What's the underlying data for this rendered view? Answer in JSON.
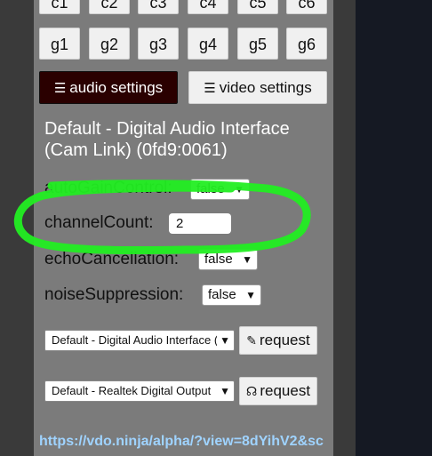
{
  "top_keys": [
    "c1",
    "c2",
    "c3",
    "c4",
    "c5",
    "c6"
  ],
  "g_keys": [
    "g1",
    "g2",
    "g3",
    "g4",
    "g5",
    "g6"
  ],
  "tabs": {
    "audio": {
      "label": "audio settings",
      "icon": "sliders-icon"
    },
    "video": {
      "label": "video settings",
      "icon": "sliders-icon"
    }
  },
  "device": {
    "title": "Default - Digital Audio Interface (Cam Link) (0fd9:0061)"
  },
  "settings": {
    "auto_gain": {
      "label": "autoGainControl:",
      "value": "false"
    },
    "channel_count": {
      "label": "channelCount:",
      "value": "2"
    },
    "echo": {
      "label": "echoCancellation:",
      "value": "false"
    },
    "noise": {
      "label": "noiseSuppression:",
      "value": "false"
    }
  },
  "audio_input": {
    "selected": "Default - Digital Audio Interface (Cam Link)",
    "button": "request",
    "icon": "pencil-icon"
  },
  "audio_output": {
    "selected": "Default - Realtek Digital Output",
    "button": "request",
    "icon": "headphones-icon"
  },
  "link": "https://vdo.ninja/alpha/?view=8dYihV2&sc",
  "colors": {
    "background": "#151923",
    "panel": "#7b7b7b",
    "active_tab": "#2a0000",
    "highlight_annotation": "#22ee22",
    "link": "#9fd3ff"
  }
}
